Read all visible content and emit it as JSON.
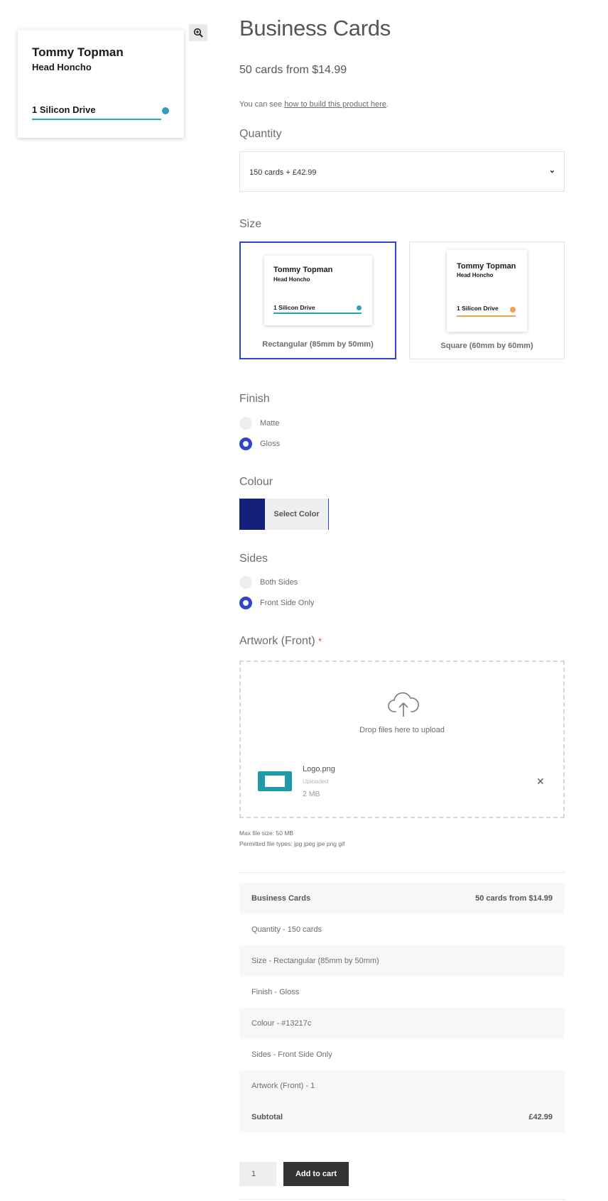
{
  "gallery": {
    "card_name": "Tommy Topman",
    "card_role": "Head Honcho",
    "card_address": "1 Silicon Drive",
    "accent": "#2e9fbd"
  },
  "product": {
    "title": "Business Cards",
    "price": "50 cards from $14.99",
    "help_prefix": "You can see ",
    "help_link": "how to build this product here",
    "help_suffix": "."
  },
  "quantity": {
    "label": "Quantity",
    "selected": "150 cards + £42.99"
  },
  "size": {
    "label": "Size",
    "options": [
      {
        "caption": "Rectangular (85mm by 50mm)",
        "name": "Tommy Topman",
        "role": "Head Honcho",
        "address": "1 Silicon Drive",
        "accent": "#2e9fbd",
        "selected": true
      },
      {
        "caption": "Square (60mm by 60mm)",
        "name": "Tommy Topman",
        "role": "Head Honcho",
        "address": "1 Silicon Drive",
        "accent": "#f0a050",
        "selected": false
      }
    ]
  },
  "finish": {
    "label": "Finish",
    "options": [
      {
        "label": "Matte",
        "checked": false
      },
      {
        "label": "Gloss",
        "checked": true
      }
    ]
  },
  "colour": {
    "label": "Colour",
    "button_label": "Select Color",
    "value": "#13217c"
  },
  "sides": {
    "label": "Sides",
    "options": [
      {
        "label": "Both Sides",
        "checked": false
      },
      {
        "label": "Front Side Only",
        "checked": true
      }
    ]
  },
  "artwork": {
    "label": "Artwork (Front)",
    "required_mark": "*",
    "drop_text": "Drop files here to upload",
    "file_name": "Logo.png",
    "file_status": "Uploaded",
    "file_size": "2 MB",
    "max_size": "Max file size: 50 MB",
    "permitted": "Permitted file types: jpg jpeg jpe png gif"
  },
  "summary": {
    "rows": [
      {
        "left": "Business Cards",
        "right": "50 cards from $14.99"
      },
      {
        "left": "Quantity - 150 cards",
        "right": ""
      },
      {
        "left": "Size - Rectangular (85mm by 50mm)",
        "right": ""
      },
      {
        "left": "Finish - Gloss",
        "right": ""
      },
      {
        "left": "Colour - #13217c",
        "right": ""
      },
      {
        "left": "Sides - Front Side Only",
        "right": ""
      },
      {
        "left": "Artwork (Front) - 1",
        "right": ""
      },
      {
        "left": "Subtotal",
        "right": "£42.99"
      }
    ]
  },
  "cart": {
    "quantity": "1",
    "add_label": "Add to cart"
  }
}
